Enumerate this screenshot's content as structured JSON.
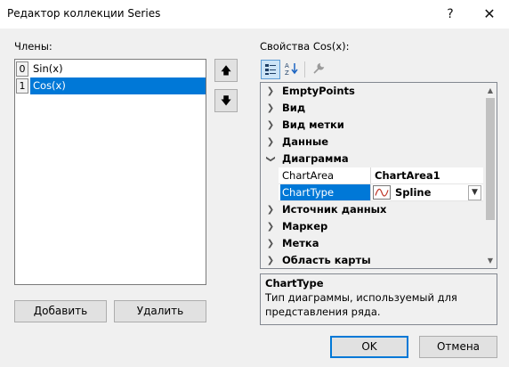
{
  "window": {
    "title": "Редактор коллекции Series",
    "help_glyph": "?",
    "close_glyph": "✕"
  },
  "members": {
    "label": "Члены:",
    "items": [
      {
        "index": "0",
        "name": "Sin(x)",
        "selected": false
      },
      {
        "index": "1",
        "name": "Cos(x)",
        "selected": true
      }
    ],
    "move_up_glyph": "🡅",
    "move_down_glyph": "🡇",
    "add_label": "Добавить",
    "remove_label": "Удалить"
  },
  "properties": {
    "label": "Свойства Cos(x):",
    "toolbar": {
      "categorized_icon": "categorized-icon",
      "alphabetical_icon": "alphabetical-icon",
      "property_pages_icon": "wrench-icon",
      "categorized_active": true
    },
    "rows": [
      {
        "kind": "category",
        "label": "EmptyPoints",
        "expanded": false
      },
      {
        "kind": "category",
        "label": "Вид",
        "expanded": false
      },
      {
        "kind": "category",
        "label": "Вид метки",
        "expanded": false
      },
      {
        "kind": "category",
        "label": "Данные",
        "expanded": false
      },
      {
        "kind": "category",
        "label": "Диаграмма",
        "expanded": true
      },
      {
        "kind": "property",
        "name": "ChartArea",
        "value": "ChartArea1",
        "selected": false
      },
      {
        "kind": "property",
        "name": "ChartType",
        "value": "Spline",
        "selected": true,
        "has_dropdown": true,
        "icon": "spline-chart-icon"
      },
      {
        "kind": "category",
        "label": "Источник данных",
        "expanded": false
      },
      {
        "kind": "category",
        "label": "Маркер",
        "expanded": false
      },
      {
        "kind": "category",
        "label": "Метка",
        "expanded": false
      },
      {
        "kind": "category",
        "label": "Область карты",
        "expanded": false
      }
    ],
    "help": {
      "title": "ChartType",
      "description": "Тип диаграммы, используемый для представления ряда."
    }
  },
  "footer": {
    "ok_label": "OK",
    "cancel_label": "Отмена"
  },
  "colors": {
    "selection": "#0078d7",
    "dialog_bg": "#f0f0f0",
    "spline_line": "#c0392b"
  }
}
